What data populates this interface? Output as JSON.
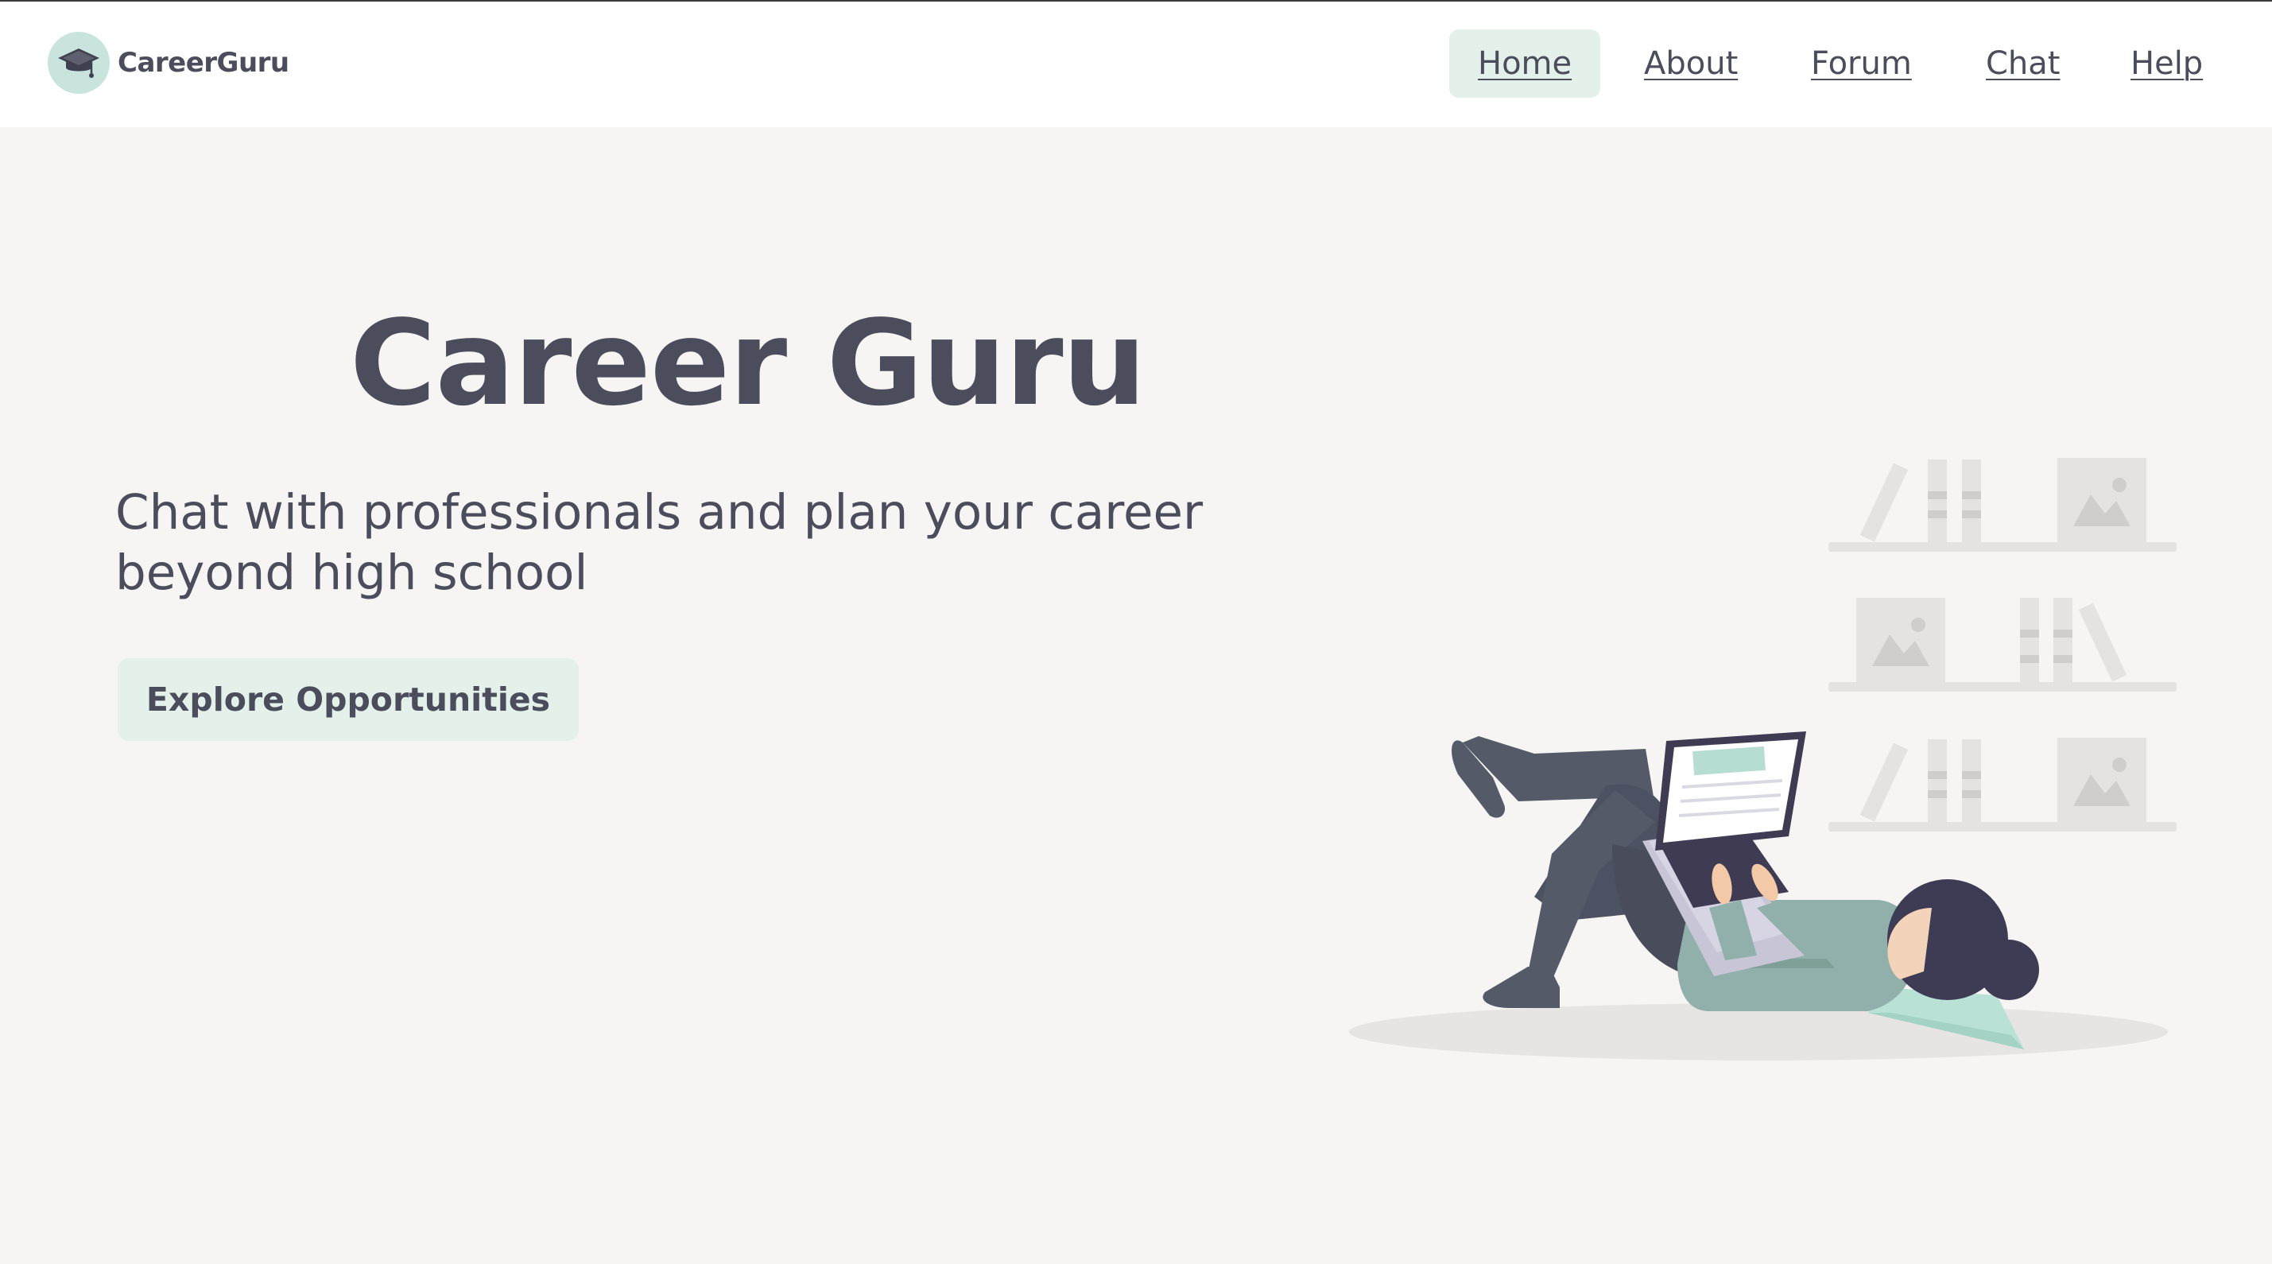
{
  "app": {
    "name": "CareerGuru",
    "logo_icon": "graduation-cap-icon",
    "colors": {
      "text": "#4b4d5c",
      "accent_bg": "#e3f1ea",
      "logo_bg": "#c9e4dd",
      "page_bg": "#f6f5f3"
    }
  },
  "nav": {
    "items": [
      {
        "label": "Home",
        "active": true
      },
      {
        "label": "About",
        "active": false
      },
      {
        "label": "Forum",
        "active": false
      },
      {
        "label": "Chat",
        "active": false
      },
      {
        "label": "Help",
        "active": false
      }
    ]
  },
  "hero": {
    "title": "Career Guru",
    "subtitle": "Chat with professionals and plan your career beyond high school",
    "cta_label": "Explore Opportunities"
  }
}
